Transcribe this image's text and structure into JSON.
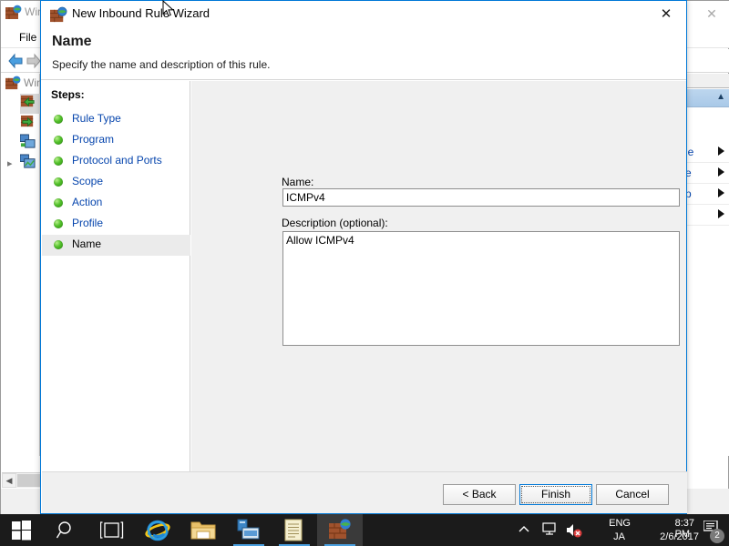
{
  "background_window": {
    "title": "Win",
    "title_icon": "firewall-icon",
    "menu": {
      "file": "File"
    },
    "nav": {
      "back": "back-arrow-icon",
      "forward": "forward-arrow-icon"
    },
    "tree_root_label": "Win",
    "actions_pane": {
      "rows": [
        "le",
        "e",
        "p",
        ""
      ]
    },
    "close_label": "✕"
  },
  "dialog": {
    "title": "New Inbound Rule Wizard",
    "title_icon": "firewall-rule-icon",
    "close_label": "✕",
    "heading": "Name",
    "subheading": "Specify the name and description of this rule.",
    "steps_label": "Steps:",
    "steps": [
      {
        "label": "Rule Type",
        "current": false
      },
      {
        "label": "Program",
        "current": false
      },
      {
        "label": "Protocol and Ports",
        "current": false
      },
      {
        "label": "Scope",
        "current": false
      },
      {
        "label": "Action",
        "current": false
      },
      {
        "label": "Profile",
        "current": false
      },
      {
        "label": "Name",
        "current": true
      }
    ],
    "form": {
      "name_label": "Name:",
      "name_value": "ICMPv4",
      "name_placeholder": "",
      "description_label": "Description (optional):",
      "description_value": "Allow ICMPv4",
      "description_placeholder": ""
    },
    "buttons": {
      "back": "< Back",
      "finish": "Finish",
      "cancel": "Cancel"
    }
  },
  "taskbar": {
    "start": "start-icon",
    "items": [
      {
        "name": "search-icon",
        "active": false
      },
      {
        "name": "task-view-icon",
        "active": false
      },
      {
        "name": "internet-explorer-icon",
        "active": false
      },
      {
        "name": "file-explorer-icon",
        "active": false
      },
      {
        "name": "server-manager-icon",
        "active": false
      },
      {
        "name": "notepad-icon",
        "active": false
      },
      {
        "name": "windows-firewall-icon",
        "active": true
      }
    ],
    "tray": {
      "chevron": "chevron-up-icon",
      "network": "network-icon",
      "volume": "volume-muted-icon",
      "language_primary": "ENG",
      "language_secondary": "JA",
      "time": "8:37 PM",
      "date": "2/6/2017",
      "notification_count": "2"
    }
  },
  "colors": {
    "accent": "#0078d7",
    "taskbar": "#1b1b1b",
    "dialog_bg": "#f0f0f0",
    "link": "#0645ad",
    "step_bullet": "#52c02a"
  }
}
